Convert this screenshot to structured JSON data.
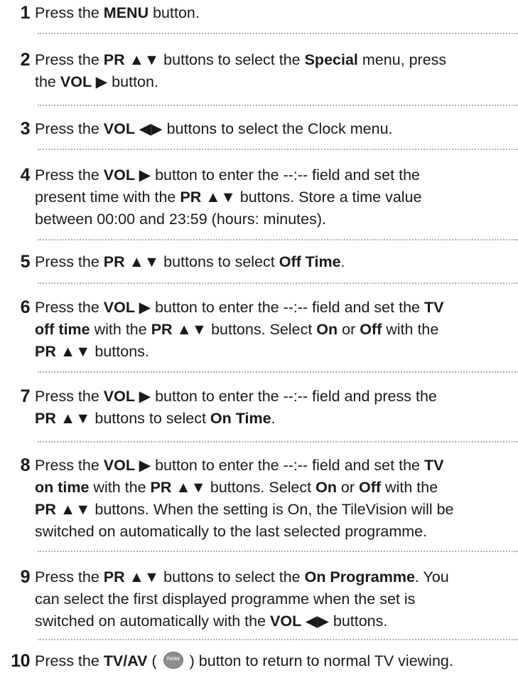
{
  "steps": [
    {
      "number": "1",
      "lines": [
        [
          {
            "t": "Press the "
          },
          {
            "t": "MENU",
            "b": true
          },
          {
            "t": " button."
          }
        ]
      ]
    },
    {
      "number": "2",
      "lines": [
        [
          {
            "t": "Press the "
          },
          {
            "t": "PR ▲▼",
            "b": true
          },
          {
            "t": " buttons to select the "
          },
          {
            "t": "Special",
            "b": true
          },
          {
            "t": " menu, press"
          }
        ],
        [
          {
            "t": "the "
          },
          {
            "t": "VOL ▶",
            "b": true
          },
          {
            "t": " button."
          }
        ]
      ]
    },
    {
      "number": "3",
      "lines": [
        [
          {
            "t": "Press the "
          },
          {
            "t": "VOL ◀▶",
            "b": true
          },
          {
            "t": " buttons to select the Clock menu."
          }
        ]
      ]
    },
    {
      "number": "4",
      "lines": [
        [
          {
            "t": "Press the "
          },
          {
            "t": "VOL ▶",
            "b": true
          },
          {
            "t": " button to enter the --:-- field and set the"
          }
        ],
        [
          {
            "t": "present time with the "
          },
          {
            "t": "PR ▲▼",
            "b": true
          },
          {
            "t": " buttons. Store a time value"
          }
        ],
        [
          {
            "t": "between 00:00 and 23:59 (hours: minutes)."
          }
        ]
      ]
    },
    {
      "number": "5",
      "lines": [
        [
          {
            "t": "Press the "
          },
          {
            "t": "PR ▲▼",
            "b": true
          },
          {
            "t": " buttons to select "
          },
          {
            "t": "Off Time",
            "b": true
          },
          {
            "t": "."
          }
        ]
      ]
    },
    {
      "number": "6",
      "lines": [
        [
          {
            "t": "Press the "
          },
          {
            "t": "VOL ▶",
            "b": true
          },
          {
            "t": " button to enter the --:-- field and set the "
          },
          {
            "t": "TV",
            "b": true
          }
        ],
        [
          {
            "t": "off time",
            "b": true
          },
          {
            "t": " with the "
          },
          {
            "t": "PR ▲▼",
            "b": true
          },
          {
            "t": " buttons. Select "
          },
          {
            "t": "On",
            "b": true
          },
          {
            "t": " or "
          },
          {
            "t": "Off",
            "b": true
          },
          {
            "t": " with the"
          }
        ],
        [
          {
            "t": "PR ▲▼",
            "b": true
          },
          {
            "t": " buttons."
          }
        ]
      ]
    },
    {
      "number": "7",
      "lines": [
        [
          {
            "t": "Press the "
          },
          {
            "t": "VOL ▶",
            "b": true
          },
          {
            "t": " button to enter the --:-- field and press the"
          }
        ],
        [
          {
            "t": "PR ▲▼",
            "b": true
          },
          {
            "t": " buttons to select "
          },
          {
            "t": "On Time",
            "b": true
          },
          {
            "t": "."
          }
        ]
      ]
    },
    {
      "number": "8",
      "lines": [
        [
          {
            "t": "Press the "
          },
          {
            "t": "VOL ▶",
            "b": true
          },
          {
            "t": " button to enter the --:-- field and set the "
          },
          {
            "t": "TV",
            "b": true
          }
        ],
        [
          {
            "t": "on time",
            "b": true
          },
          {
            "t": " with the "
          },
          {
            "t": "PR ▲▼",
            "b": true
          },
          {
            "t": " buttons. Select "
          },
          {
            "t": "On",
            "b": true
          },
          {
            "t": " or "
          },
          {
            "t": "Off",
            "b": true
          },
          {
            "t": " with the"
          }
        ],
        [
          {
            "t": "PR ▲▼",
            "b": true
          },
          {
            "t": " buttons. When the setting is On, the TileVision will be"
          }
        ],
        [
          {
            "t": "switched on automatically to the last selected programme."
          }
        ]
      ]
    },
    {
      "number": "9",
      "lines": [
        [
          {
            "t": "Press the "
          },
          {
            "t": "PR ▲▼",
            "b": true
          },
          {
            "t": " buttons to select the "
          },
          {
            "t": "On Programme",
            "b": true
          },
          {
            "t": ". You"
          }
        ],
        [
          {
            "t": "can select the first displayed programme when the set is"
          }
        ],
        [
          {
            "t": "switched on automatically with the "
          },
          {
            "t": "VOL ◀▶",
            "b": true
          },
          {
            "t": " buttons."
          }
        ]
      ]
    },
    {
      "number": "10",
      "lines": [
        [
          {
            "t": "Press the "
          },
          {
            "t": "TV/AV",
            "b": true
          },
          {
            "t": " ( "
          },
          {
            "icon": "tvav-button-icon"
          },
          {
            "t": " ) button to return to normal TV viewing."
          }
        ]
      ]
    }
  ]
}
